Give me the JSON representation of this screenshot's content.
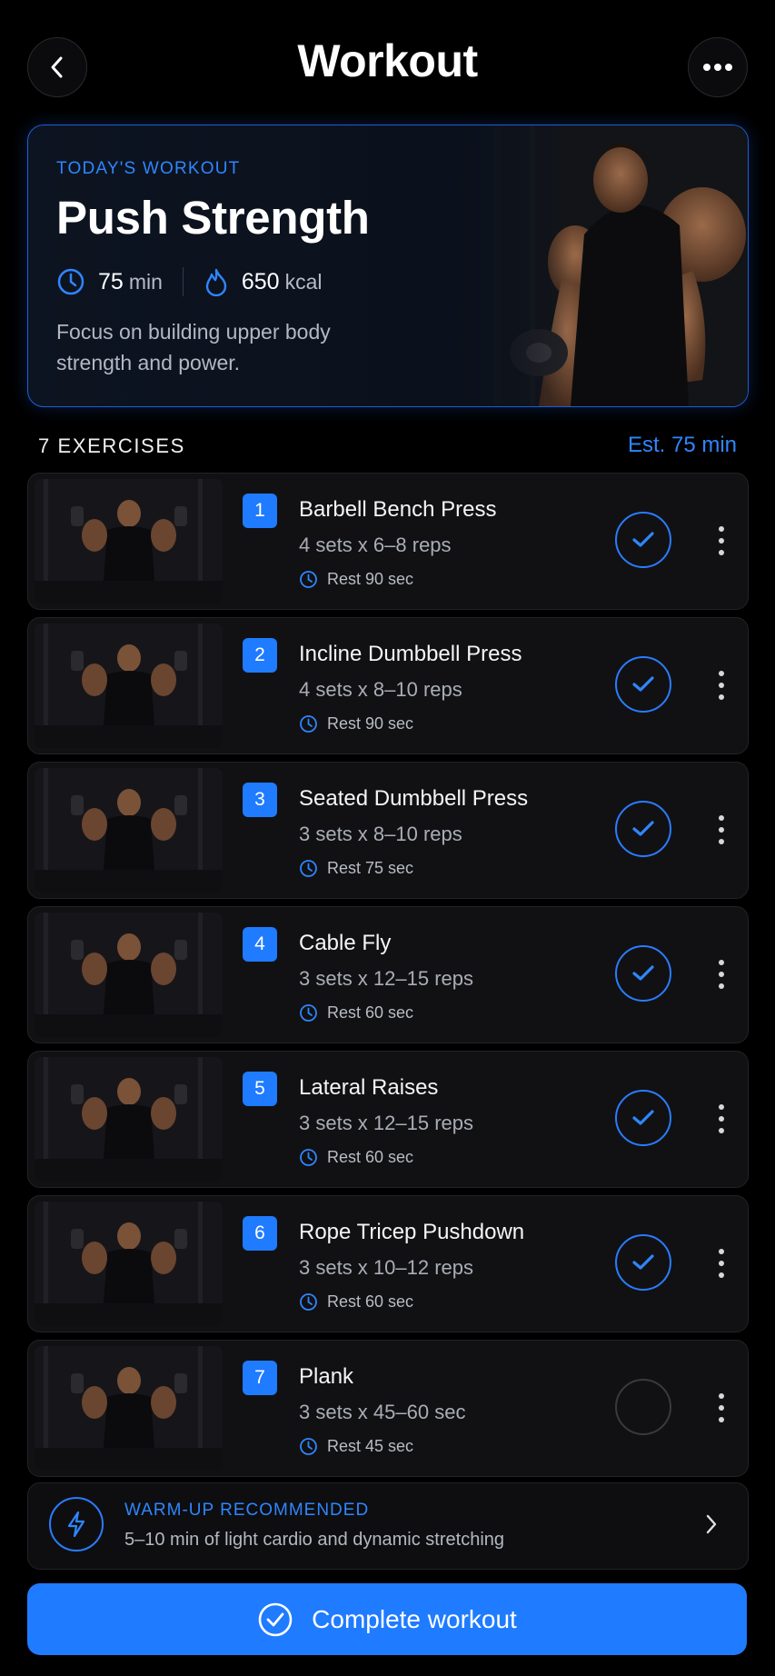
{
  "header": {
    "title": "Workout"
  },
  "hero": {
    "eyebrow": "TODAY'S WORKOUT",
    "title": "Push Strength",
    "duration_value": "75",
    "duration_unit": "min",
    "calories_value": "650",
    "calories_unit": "kcal",
    "description": "Focus on building upper body strength and power."
  },
  "list": {
    "count_label": "7 EXERCISES",
    "estimate": "Est. 75 min"
  },
  "exercises": [
    {
      "number": "1",
      "name": "Barbell Bench Press",
      "sets": "4 sets  x  6–8 reps",
      "rest": "Rest 90 sec",
      "completed": true
    },
    {
      "number": "2",
      "name": "Incline Dumbbell Press",
      "sets": "4 sets  x  8–10 reps",
      "rest": "Rest 90 sec",
      "completed": true
    },
    {
      "number": "3",
      "name": "Seated Dumbbell Press",
      "sets": "3 sets  x  8–10 reps",
      "rest": "Rest 75 sec",
      "completed": true
    },
    {
      "number": "4",
      "name": "Cable Fly",
      "sets": "3 sets  x  12–15 reps",
      "rest": "Rest 60 sec",
      "completed": true
    },
    {
      "number": "5",
      "name": "Lateral Raises",
      "sets": "3 sets  x  12–15 reps",
      "rest": "Rest 60 sec",
      "completed": true
    },
    {
      "number": "6",
      "name": "Rope Tricep Pushdown",
      "sets": "3 sets  x  10–12 reps",
      "rest": "Rest 60 sec",
      "completed": true
    },
    {
      "number": "7",
      "name": "Plank",
      "sets": "3 sets  x  45–60 sec",
      "rest": "Rest 45 sec",
      "completed": false
    }
  ],
  "warmup": {
    "title": "WARM-UP RECOMMENDED",
    "subtitle": "5–10 min of light cardio and dynamic stretching"
  },
  "cta": {
    "label": "Complete workout"
  },
  "colors": {
    "accent": "#1f7bff",
    "background": "#000000",
    "card": "#111113"
  }
}
